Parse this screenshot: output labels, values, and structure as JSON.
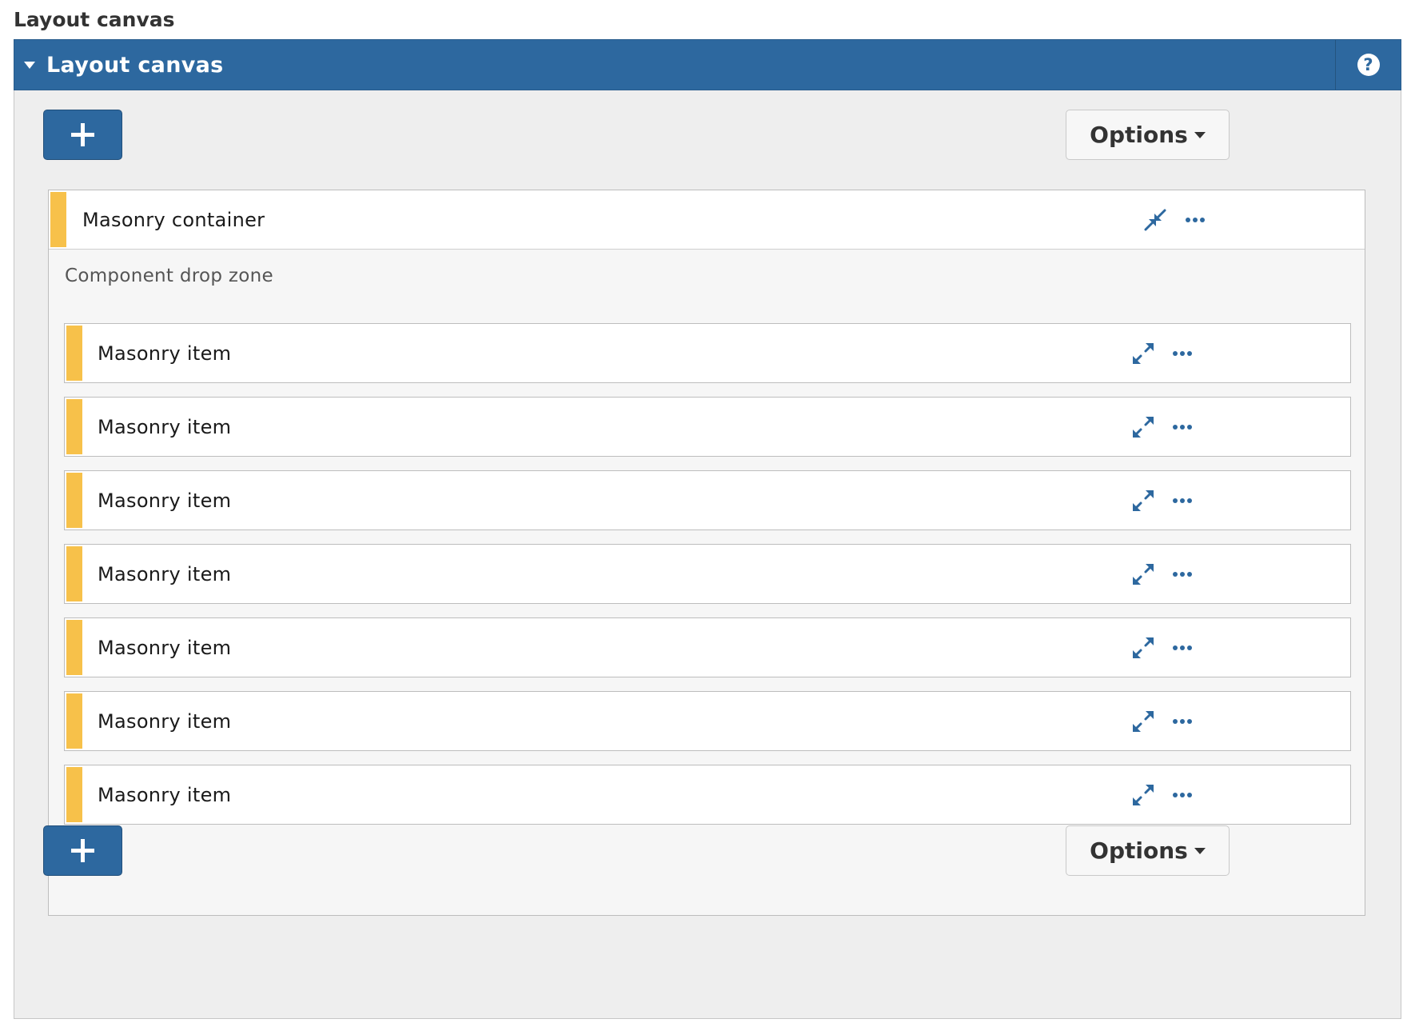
{
  "page": {
    "heading": "Layout canvas"
  },
  "panel": {
    "title": "Layout canvas",
    "help_icon_glyph": "?",
    "accent_color": "#2d689f"
  },
  "toolbar_top": {
    "options_label": "Options"
  },
  "toolbar_bottom": {
    "options_label": "Options"
  },
  "container": {
    "label": "Masonry container",
    "drop_zone_label": "Component drop zone",
    "accent_color": "#f7c14a",
    "items": [
      {
        "label": "Masonry item"
      },
      {
        "label": "Masonry item"
      },
      {
        "label": "Masonry item"
      },
      {
        "label": "Masonry item"
      },
      {
        "label": "Masonry item"
      },
      {
        "label": "Masonry item"
      },
      {
        "label": "Masonry item"
      }
    ]
  },
  "icons": {
    "add": "plus-icon",
    "help": "question-circle-icon",
    "collapse": "compress-icon",
    "expand": "expand-icon",
    "more": "ellipsis-icon",
    "dropdown": "caret-down-icon"
  }
}
